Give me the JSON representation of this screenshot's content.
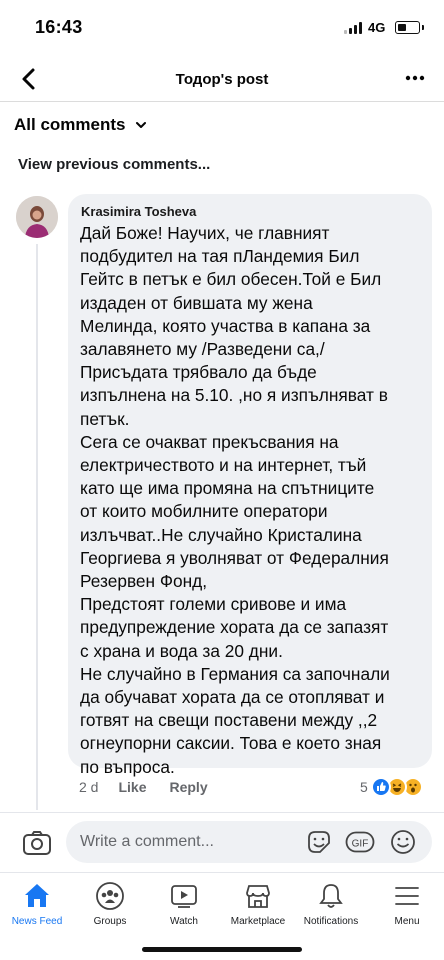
{
  "status_bar": {
    "time": "16:43",
    "network": "4G"
  },
  "header": {
    "title": "Тодор's post"
  },
  "filter": {
    "label": "All comments"
  },
  "view_previous": "View previous comments...",
  "comment": {
    "author": "Krasimira Tosheva",
    "lines": [
      "Дай Боже! Научих, че главният",
      "подбудител на тая пЛандемия Бил",
      "Гейтс в петък е бил обесен.Той е Бил",
      "издаден от бившата му жена",
      "Мелинда, която  участва в капана за",
      "залавянето му  /Разведени са,/",
      "Присъдата трябвало да бъде",
      "изпълнена на 5.10.  ,но я изпълняват в",
      "петък.",
      "Сега се очакват прекъсвания на",
      "електричеството и на интернет, тъй",
      "като ще има промяна на спътниците",
      "от които мобилните оператори",
      "излъчват..Не случайно Кристалина",
      "Георгиева я уволняват от Федералния",
      "Резервен Фонд,",
      "Предстоят големи сривове и има",
      "предупреждение хората да се запазят",
      "с храна и вода за 20 дни.",
      "Не случайно в Германия са започнали",
      "да обучават хората да се отопляват и",
      "готвят на свещи поставени между ,,2",
      "огнеупорни саксии. Това е което зная",
      "по въпроса."
    ],
    "time": "2 d",
    "like_label": "Like",
    "reply_label": "Reply",
    "reaction_count": "5",
    "reactions": [
      "like-icon",
      "haha-icon",
      "wow-icon"
    ]
  },
  "composer": {
    "placeholder": "Write a comment...",
    "gif_label": "GIF"
  },
  "bottom_nav": {
    "items": [
      {
        "label": "News Feed",
        "icon": "home-icon",
        "active": true
      },
      {
        "label": "Groups",
        "icon": "groups-icon"
      },
      {
        "label": "Watch",
        "icon": "watch-icon"
      },
      {
        "label": "Marketplace",
        "icon": "marketplace-icon"
      },
      {
        "label": "Notifications",
        "icon": "bell-icon"
      },
      {
        "label": "Menu",
        "icon": "menu-icon"
      }
    ]
  },
  "colors": {
    "accent": "#1877f2",
    "bubble": "#eff1f4",
    "secondary_text": "#65676b"
  }
}
